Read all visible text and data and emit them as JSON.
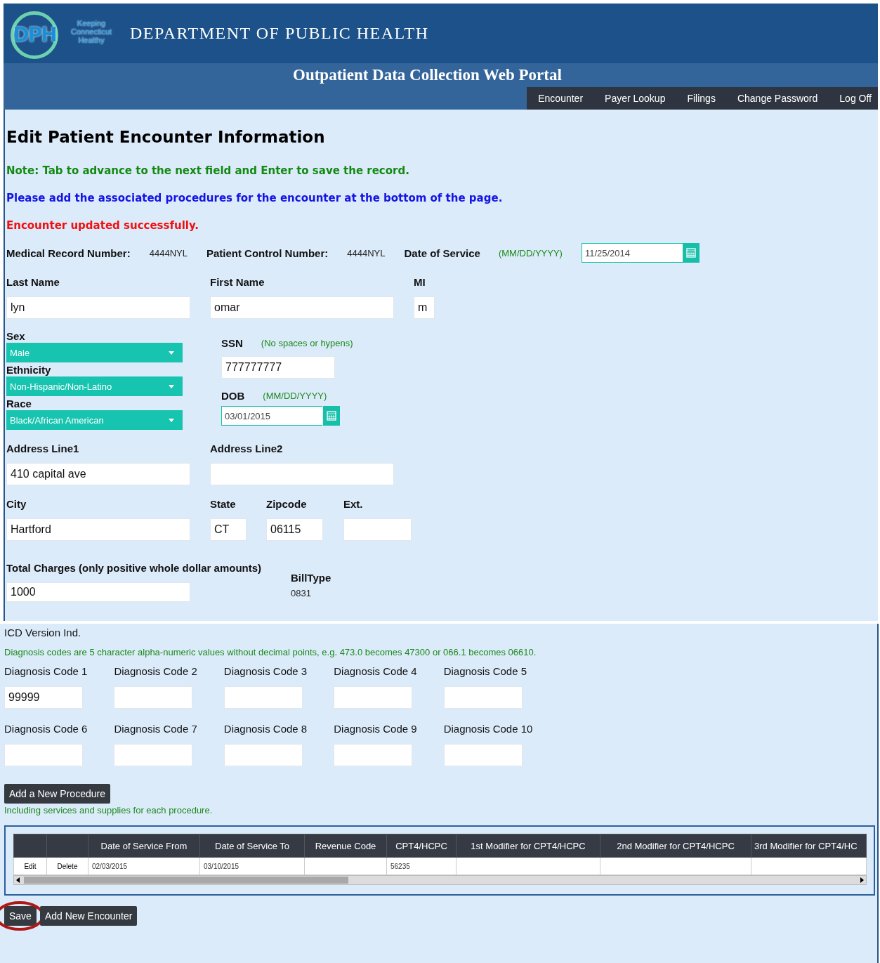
{
  "header": {
    "logo_mark": "DPH",
    "logo_tagline": [
      "Keeping",
      "Connecticut",
      "Healthy"
    ],
    "title": "DEPARTMENT OF PUBLIC HEALTH",
    "subtitle": "Outpatient Data Collection Web Portal"
  },
  "nav": [
    {
      "label": "Encounter"
    },
    {
      "label": "Payer Lookup"
    },
    {
      "label": "Filings"
    },
    {
      "label": "Change Password"
    },
    {
      "label": "Log Off"
    }
  ],
  "page_title": "Edit Patient Encounter Information",
  "messages": [
    {
      "kind": "note",
      "text": "Note: Tab to advance to the next field and Enter to save the record."
    },
    {
      "kind": "info",
      "text": "Please add the associated procedures for the encounter at the bottom of the page."
    },
    {
      "kind": "alert",
      "text": "Encounter updated successfully."
    }
  ],
  "record": {
    "mrn_label": "Medical Record Number:",
    "mrn_value": "4444NYL",
    "pcn_label": "Patient Control Number:",
    "pcn_value": "4444NYL",
    "dos_label": "Date of Service",
    "dos_hint": "(MM/DD/YYYY)",
    "dos_value": "11/25/2014"
  },
  "name_fields": [
    {
      "label": "Last Name",
      "value": "lyn"
    },
    {
      "label": "First Name",
      "value": "omar"
    },
    {
      "label": "MI",
      "value": "m"
    }
  ],
  "selects": [
    {
      "label": "Sex",
      "value": "Male"
    },
    {
      "label": "Ethnicity",
      "value": "Non-Hispanic/Non-Latino"
    },
    {
      "label": "Race",
      "value": "Black/African American"
    }
  ],
  "ssn": {
    "label": "SSN",
    "hint": "(No spaces or hypens)",
    "value": "777777777"
  },
  "dob": {
    "label": "DOB",
    "hint": "(MM/DD/YYYY)",
    "value": "03/01/2015"
  },
  "address_fields": [
    {
      "label": "Address Line1",
      "value": "410 capital ave"
    },
    {
      "label": "Address Line2"
    }
  ],
  "city_fields": [
    {
      "label": "City",
      "value": "Hartford"
    },
    {
      "label": "State",
      "value": "CT"
    },
    {
      "label": "Zipcode",
      "value": "06115"
    },
    {
      "label": "Ext."
    }
  ],
  "charges": {
    "label": "Total Charges (only positive whole dollar amounts)",
    "value": "1000"
  },
  "bill_type": {
    "label": "BillType",
    "value": "0831"
  },
  "icd_label": "ICD Version Ind.",
  "diagnosis_hint": "Diagnosis codes are 5 character alpha-numeric values without decimal points, e.g. 473.0 becomes 47300 or 066.1 becomes 06610.",
  "diagnosis_rows": [
    [
      {
        "label": "Diagnosis Code 1",
        "value": "99999"
      },
      {
        "label": "Diagnosis Code 2"
      },
      {
        "label": "Diagnosis Code 3"
      },
      {
        "label": "Diagnosis Code 4"
      },
      {
        "label": "Diagnosis Code 5"
      }
    ],
    [
      {
        "label": "Diagnosis Code 6"
      },
      {
        "label": "Diagnosis Code 7"
      },
      {
        "label": "Diagnosis Code 8"
      },
      {
        "label": "Diagnosis Code 9"
      },
      {
        "label": "Diagnosis Code 10"
      }
    ]
  ],
  "add_procedure_button": "Add a New Procedure",
  "procedure_hint": "Including services and supplies for each procedure.",
  "procedures": {
    "columns": [
      "Date of Service From",
      "Date of Service To",
      "Revenue Code",
      "CPT4/HCPC",
      "1st Modifier for CPT4/HCPC",
      "2nd Modifier for CPT4/HCPC",
      "3rd Modifier for CPT4/HC"
    ],
    "rows": [
      {
        "edit": "Edit",
        "delete": "Delete",
        "cells": [
          "02/03/2015",
          "03/10/2015",
          null,
          "56235",
          null,
          null,
          null
        ]
      }
    ]
  },
  "buttons": [
    {
      "label": "Save",
      "highlighted": true
    },
    {
      "label": "Add New Encounter",
      "highlighted": false
    }
  ]
}
